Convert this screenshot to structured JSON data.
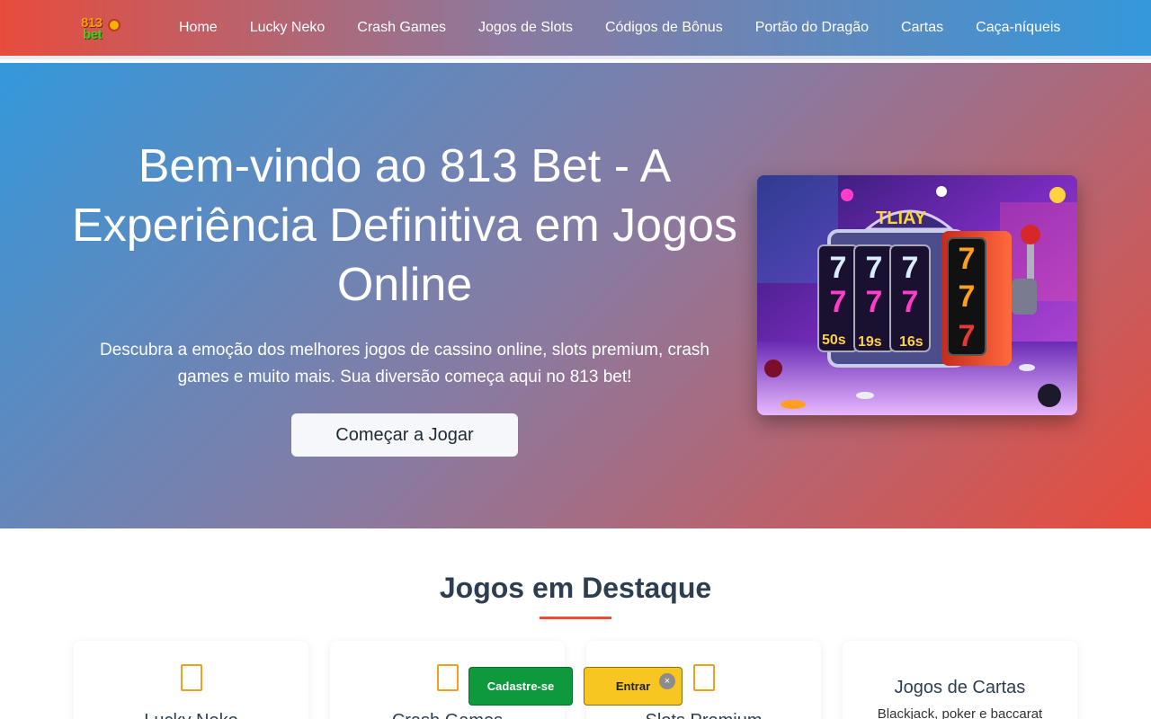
{
  "logo": {
    "line1": "813",
    "line2": "bet"
  },
  "nav": {
    "items": [
      {
        "label": "Home"
      },
      {
        "label": "Lucky Neko"
      },
      {
        "label": "Crash Games"
      },
      {
        "label": "Jogos de Slots"
      },
      {
        "label": "Códigos de Bônus"
      },
      {
        "label": "Portão do Dragão"
      },
      {
        "label": "Cartas"
      },
      {
        "label": "Caça-níqueis"
      }
    ]
  },
  "hero": {
    "title": "Bem-vindo ao 813 Bet - A Experiência Definitiva em Jogos Online",
    "subtitle": "Descubra a emoção dos melhores jogos de cassino online, slots premium, crash games e muito mais. Sua diversão começa aqui no 813 bet!",
    "cta_label": "Começar a Jogar",
    "image": {
      "sign_text": "TLIAY",
      "reel_digit": "7",
      "chip_labels": [
        "50s",
        "19s",
        "16s"
      ]
    }
  },
  "featured": {
    "title": "Jogos em Destaque",
    "cards": [
      {
        "title": "Lucky Neko",
        "icon": "game-icon"
      },
      {
        "title": "Crash Games",
        "icon": "game-icon"
      },
      {
        "title": "Slots Premium",
        "icon": "game-icon"
      },
      {
        "title": "Jogos de Cartas",
        "description": "Blackjack, poker e baccarat",
        "icon": "cards-icon"
      }
    ]
  },
  "floating": {
    "signup_label": "Cadastre-se",
    "login_label": "Entrar",
    "close_label": "×"
  },
  "colors": {
    "red": "#e74c3c",
    "blue": "#3498db",
    "green": "#0e9a3c",
    "yellow": "#f8c620",
    "heading": "#2c3e50"
  }
}
